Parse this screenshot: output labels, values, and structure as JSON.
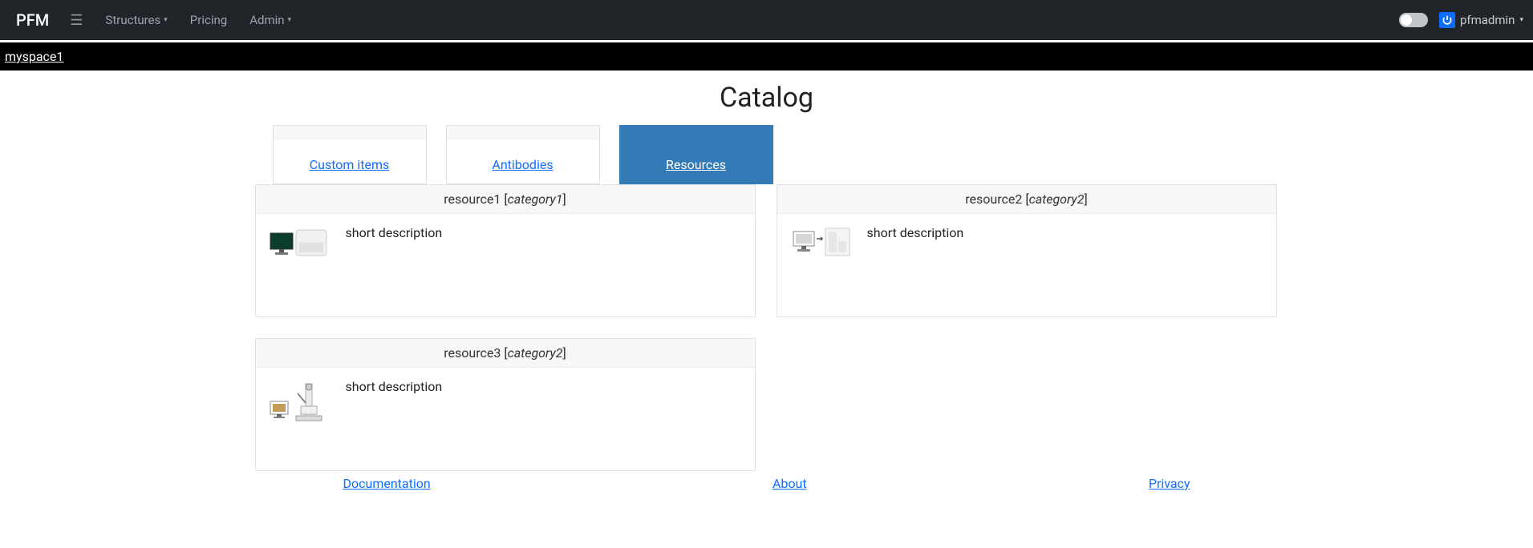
{
  "navbar": {
    "brand": "PFM",
    "items": {
      "structures": "Structures",
      "pricing": "Pricing",
      "admin": "Admin"
    },
    "user": "pfmadmin"
  },
  "subbar": {
    "space": "myspace1"
  },
  "page": {
    "title": "Catalog"
  },
  "tabs": {
    "custom_items": "Custom items",
    "antibodies": "Antibodies",
    "resources": "Resources"
  },
  "cards": [
    {
      "name": "resource1",
      "category": "category1",
      "desc": "short description"
    },
    {
      "name": "resource2",
      "category": "category2",
      "desc": "short description"
    },
    {
      "name": "resource3",
      "category": "category2",
      "desc": "short description"
    }
  ],
  "footer": {
    "documentation": "Documentation",
    "about": "About",
    "privacy": "Privacy"
  }
}
